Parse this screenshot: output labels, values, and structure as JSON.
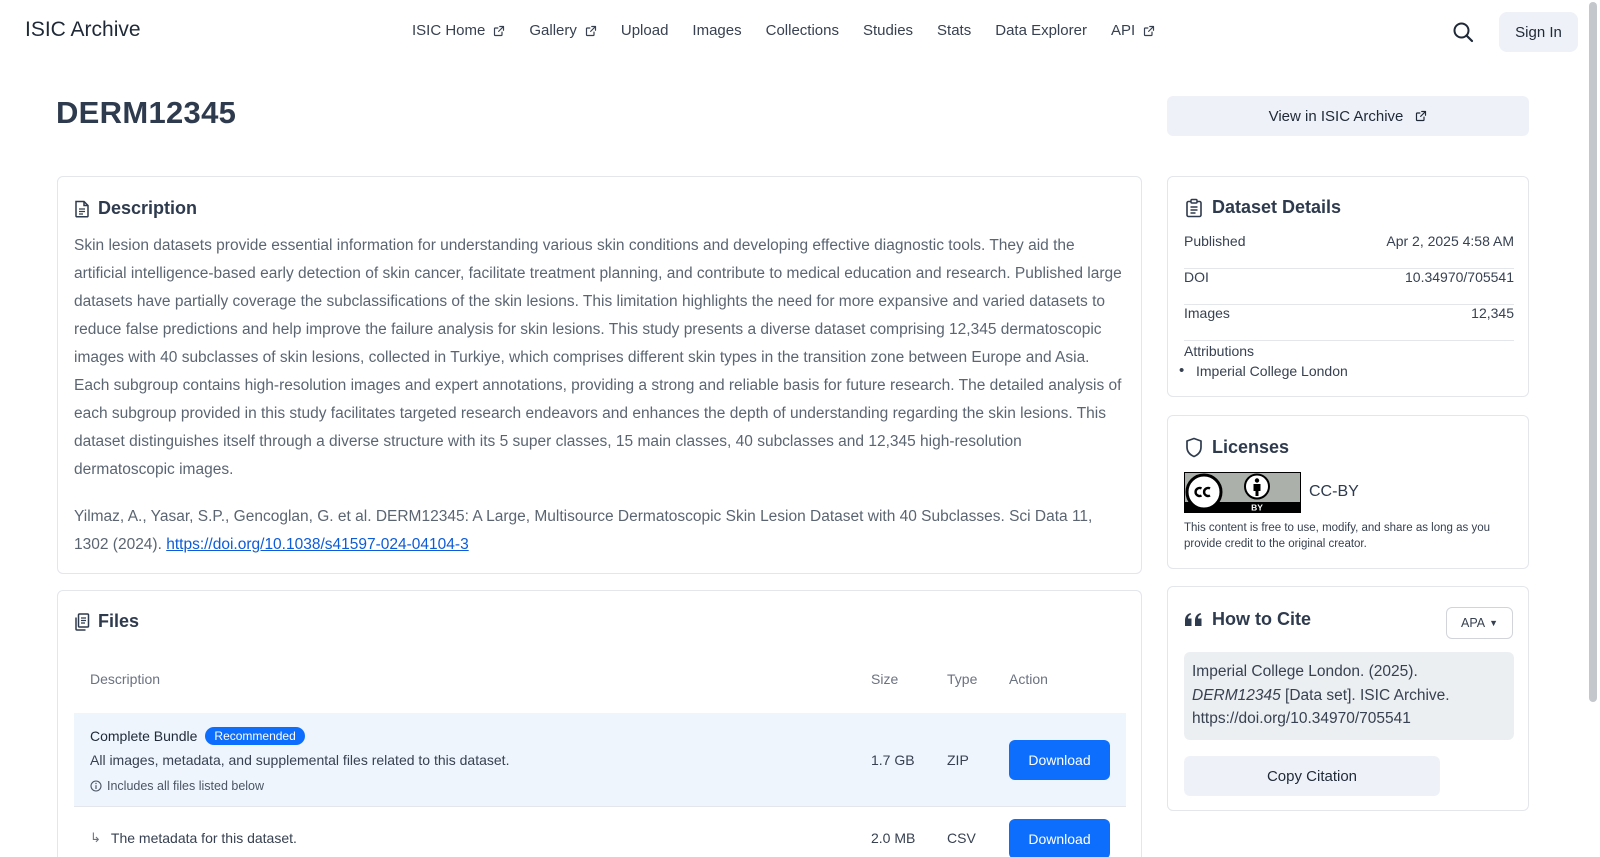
{
  "nav": {
    "brand": "ISIC Archive",
    "links": [
      "ISIC Home",
      "Gallery",
      "Upload",
      "Images",
      "Collections",
      "Studies",
      "Stats",
      "Data Explorer",
      "API"
    ],
    "sign_in": "Sign In"
  },
  "page": {
    "title": "DERM12345",
    "view_button": "View in ISIC Archive"
  },
  "description": {
    "heading": "Description",
    "body": "Skin lesion datasets provide essential information for understanding various skin conditions and developing effective diagnostic tools. They aid the artificial intelligence-based early detection of skin cancer, facilitate treatment planning, and contribute to medical education and research. Published large datasets have partially coverage the subclassifications of the skin lesions. This limitation highlights the need for more expansive and varied datasets to reduce false predictions and help improve the failure analysis for skin lesions. This study presents a diverse dataset comprising 12,345 dermatoscopic images with 40 subclasses of skin lesions, collected in Turkiye, which comprises different skin types in the transition zone between Europe and Asia. Each subgroup contains high-resolution images and expert annotations, providing a strong and reliable basis for future research. The detailed analysis of each subgroup provided in this study facilitates targeted research endeavors and enhances the depth of understanding regarding the skin lesions. This dataset distinguishes itself through a diverse structure with its 5 super classes, 15 main classes, 40 subclasses and 12,345 high-resolution dermatoscopic images.",
    "citation_text": "Yilmaz, A., Yasar, S.P., Gencoglan, G. et al. DERM12345: A Large, Multisource Dermatoscopic Skin Lesion Dataset with 40 Subclasses. Sci Data 11, 1302 (2024). ",
    "citation_link": "https://doi.org/10.1038/s41597-024-04104-3"
  },
  "files": {
    "heading": "Files",
    "columns": [
      "Description",
      "Size",
      "Type",
      "Action"
    ],
    "rows": [
      {
        "name": "Complete Bundle",
        "badge": "Recommended",
        "description": "All images, metadata, and supplemental files related to this dataset.",
        "note": "Includes all files listed below",
        "size": "1.7 GB",
        "type": "ZIP",
        "action": "Download"
      },
      {
        "arrow": "↳",
        "description": "The metadata for this dataset.",
        "size": "2.0 MB",
        "type": "CSV",
        "action": "Download"
      }
    ]
  },
  "details": {
    "heading": "Dataset Details",
    "rows": [
      {
        "label": "Published",
        "value": "Apr 2, 2025 4:58 AM"
      },
      {
        "label": "DOI",
        "value": "10.34970/705541"
      },
      {
        "label": "Images",
        "value": "12,345"
      }
    ],
    "attributions_label": "Attributions",
    "attributions": [
      "Imperial College London"
    ]
  },
  "licenses": {
    "heading": "Licenses",
    "badge_text": "BY",
    "license": "CC-BY",
    "note": "This content is free to use, modify, and share as long as you provide credit to the original creator."
  },
  "cite": {
    "heading": "How to Cite",
    "format": "APA",
    "text_before": "Imperial College London. (2025). ",
    "text_italic": "DERM12345",
    "text_after": " [Data set]. ISIC Archive. https://doi.org/10.34970/705541",
    "copy_button": "Copy Citation"
  },
  "colors": {
    "primary": "#0d6efd",
    "link": "#0d5bd7",
    "heading": "#2e3a4d",
    "muted_bg": "#eef2f8",
    "highlight_row": "#eef5fd"
  },
  "icons": [
    "external-link-icon",
    "search-icon",
    "document-icon",
    "files-icon",
    "clipboard-icon",
    "shield-icon",
    "quote-icon",
    "info-circle-icon",
    "cc-icon",
    "by-person-icon"
  ]
}
